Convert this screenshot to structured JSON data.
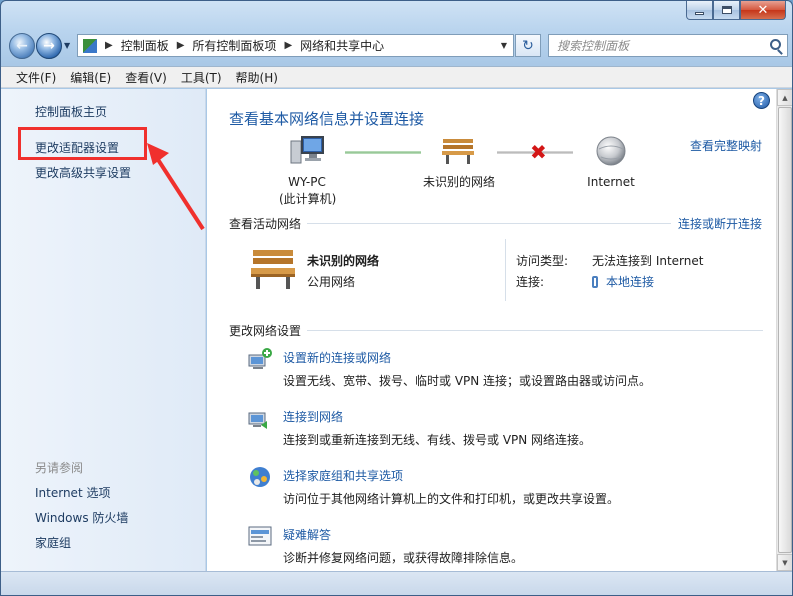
{
  "window": {
    "controls": {
      "minimize": "minimize",
      "maximize": "maximize",
      "close": "✕"
    }
  },
  "nav": {
    "breadcrumbs": [
      "控制面板",
      "所有控制面板项",
      "网络和共享中心"
    ],
    "search_placeholder": "搜索控制面板"
  },
  "menubar": {
    "items": [
      "文件(F)",
      "编辑(E)",
      "查看(V)",
      "工具(T)",
      "帮助(H)"
    ]
  },
  "sidebar": {
    "links": [
      "控制面板主页",
      "更改适配器设置",
      "更改高级共享设置"
    ],
    "see_also_title": "另请参阅",
    "see_also": [
      "Internet 选项",
      "Windows 防火墙",
      "家庭组"
    ]
  },
  "main": {
    "title": "查看基本网络信息并设置连接",
    "full_map_link": "查看完整映射",
    "map": {
      "computer_name": "WY-PC",
      "computer_sub": "(此计算机)",
      "network": "未识别的网络",
      "internet": "Internet"
    },
    "active_networks": {
      "header": "查看活动网络",
      "connect_link": "连接或断开连接",
      "network_name": "未识别的网络",
      "network_type": "公用网络",
      "access_type_label": "访问类型:",
      "access_type_value": "无法连接到 Internet",
      "connections_label": "连接:",
      "connection_link": "本地连接"
    },
    "change_settings": {
      "header": "更改网络设置",
      "tasks": [
        {
          "title": "设置新的连接或网络",
          "desc": "设置无线、宽带、拨号、临时或 VPN 连接；或设置路由器或访问点。"
        },
        {
          "title": "连接到网络",
          "desc": "连接到或重新连接到无线、有线、拨号或 VPN 网络连接。"
        },
        {
          "title": "选择家庭组和共享选项",
          "desc": "访问位于其他网络计算机上的文件和打印机，或更改共享设置。"
        },
        {
          "title": "疑难解答",
          "desc": "诊断并修复网络问题，或获得故障排除信息。"
        }
      ]
    }
  },
  "colors": {
    "link": "#1e5aa4",
    "annotation": "#f0302d"
  }
}
